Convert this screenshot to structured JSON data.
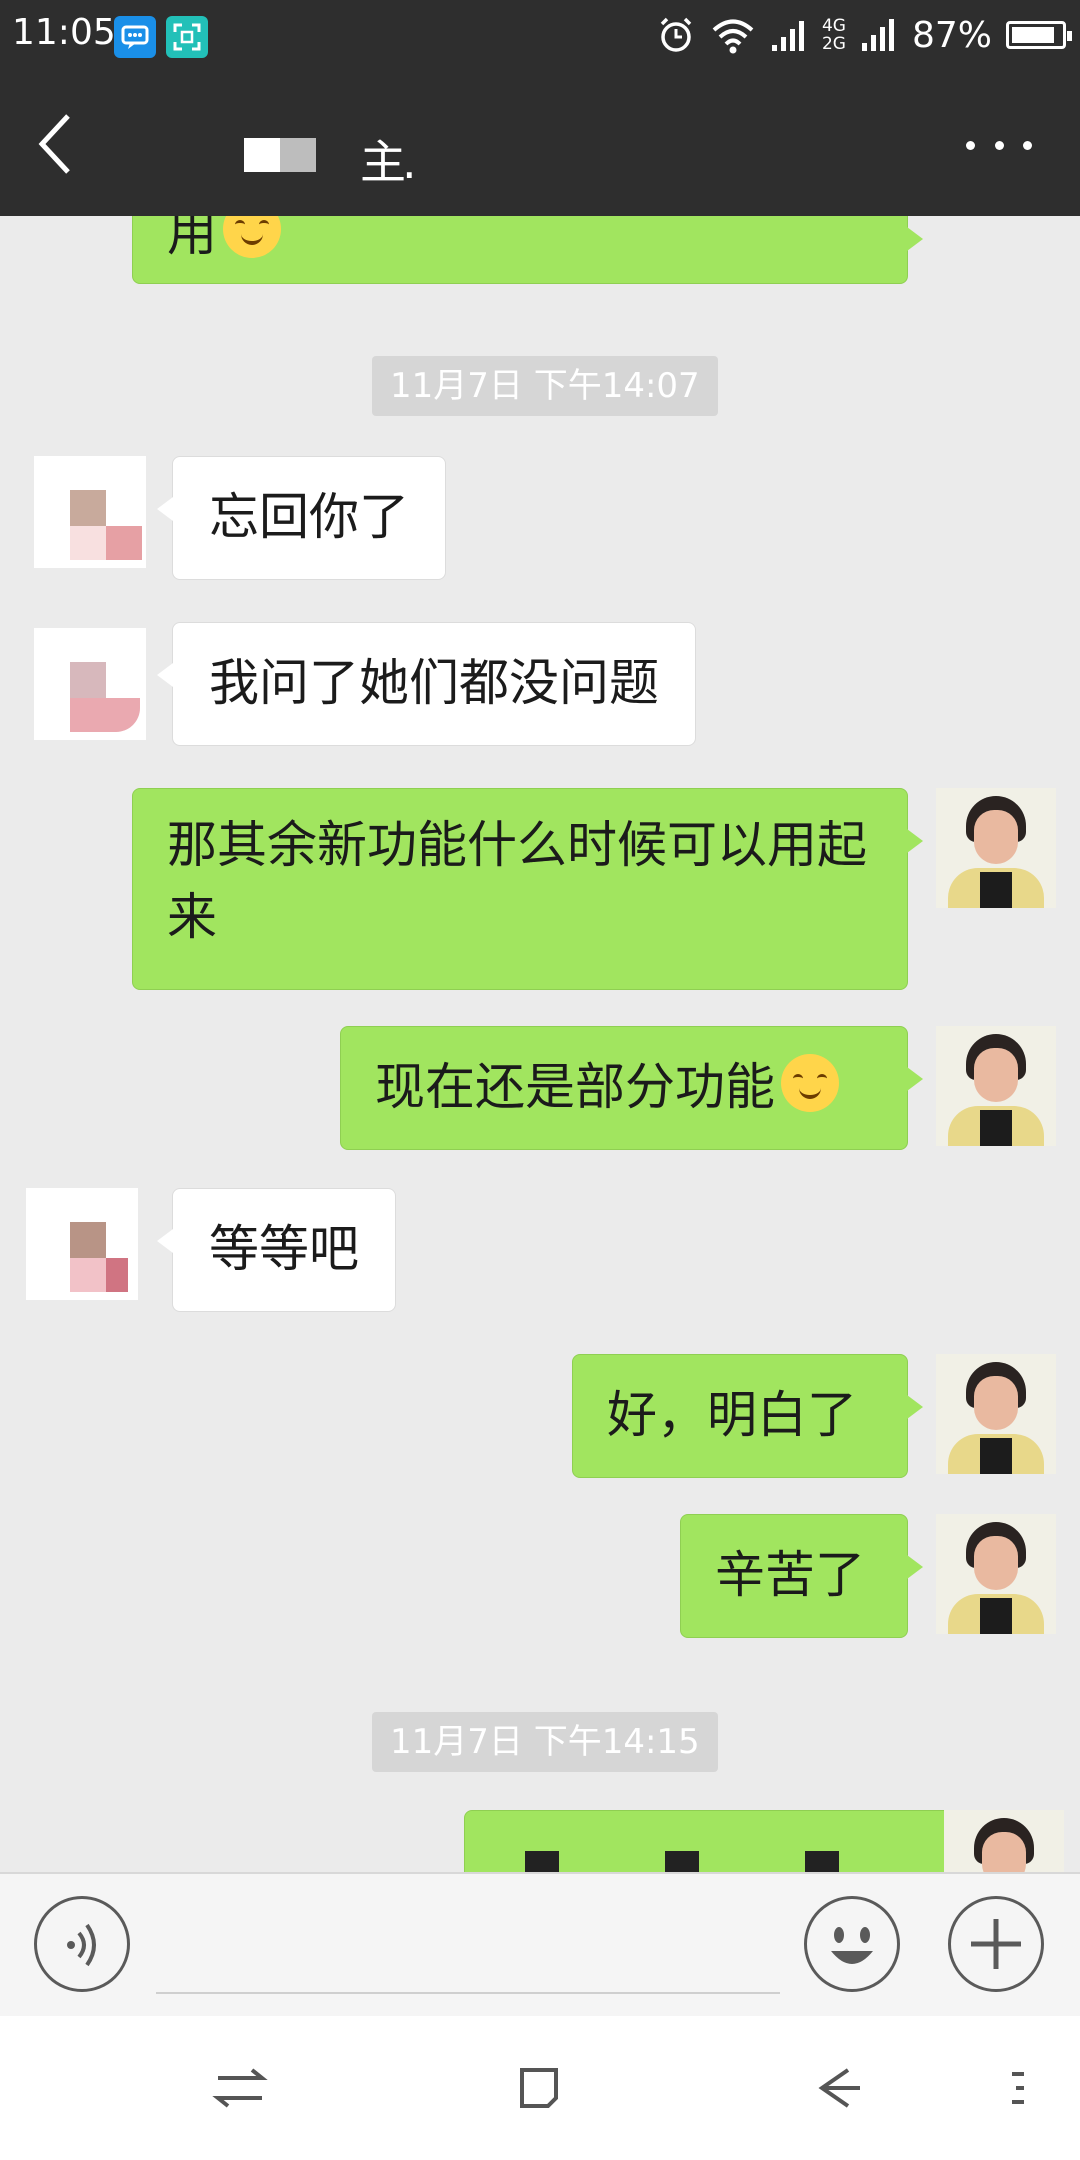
{
  "status_bar": {
    "time": "11:05",
    "network_top": "4G",
    "network_bottom": "2G",
    "battery": "87%",
    "battery_level": 0.87
  },
  "title_bar": {
    "title": "主."
  },
  "messages": [
    {
      "type": "out",
      "text": "用"
    },
    {
      "type": "time",
      "text": "11月7日 下午14:07"
    },
    {
      "type": "in",
      "text": "忘回你了"
    },
    {
      "type": "in",
      "text": "我问了她们都没问题"
    },
    {
      "type": "out",
      "text": "那其余新功能什么时候可以用起来"
    },
    {
      "type": "out",
      "text": "现在还是部分功能"
    },
    {
      "type": "in",
      "text": "等等吧"
    },
    {
      "type": "out",
      "text": "好，明白了"
    },
    {
      "type": "out",
      "text": "辛苦了"
    },
    {
      "type": "time",
      "text": "11月7日 下午14:15"
    }
  ],
  "colors": {
    "outgoing_bubble": "#a1e55f",
    "incoming_bubble": "#ffffff",
    "header": "#2e2e2e",
    "background": "#ebebeb"
  },
  "icons": {
    "back": "chevron-left-icon",
    "more": "more-horizontal-icon",
    "voice": "voice-icon",
    "emoji": "smiley-icon",
    "plus": "plus-icon",
    "nav": [
      "switch-icon",
      "square-icon",
      "back-arrow-icon",
      "menu-icon"
    ]
  }
}
